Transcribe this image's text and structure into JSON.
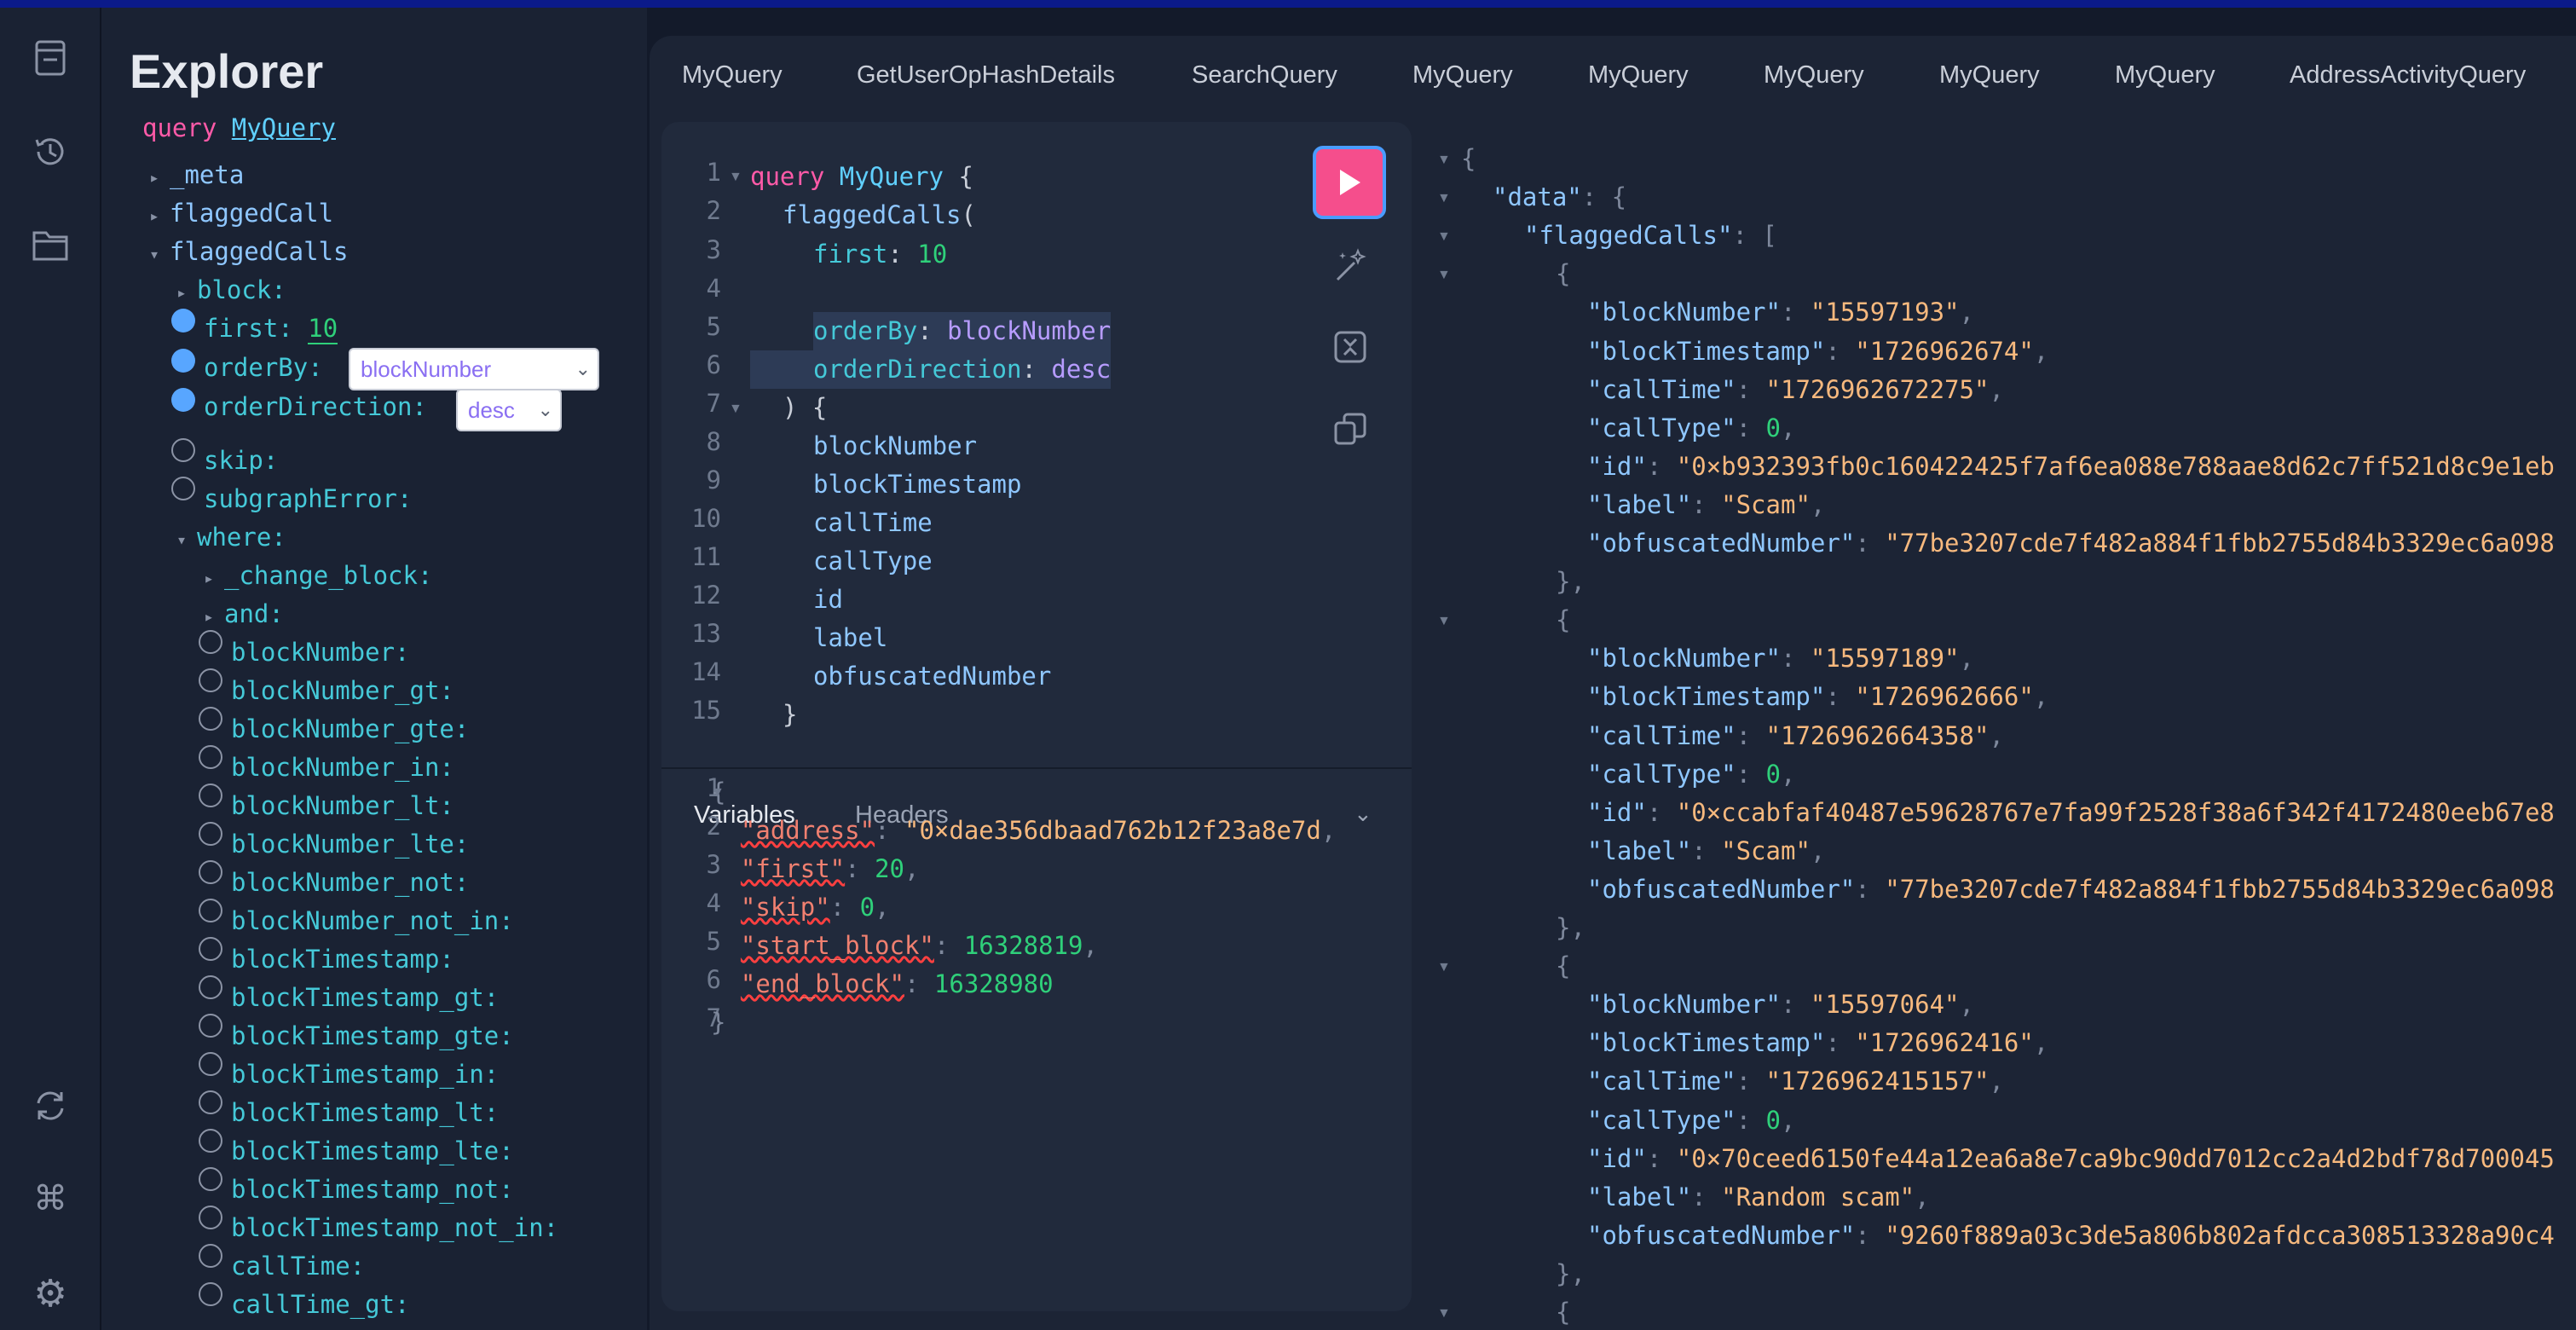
{
  "explorer": {
    "title": "Explorer",
    "query_keyword": "query",
    "query_name": "MyQuery",
    "meta": "_meta",
    "flaggedCall": "flaggedCall",
    "flaggedCalls": "flaggedCalls",
    "block": "block:",
    "first_label": "first:",
    "first_value": "10",
    "orderBy_label": "orderBy:",
    "orderBy_value": "blockNumber",
    "orderDirection_label": "orderDirection:",
    "orderDirection_value": "desc",
    "skip": "skip:",
    "subgraphError": "subgraphError:",
    "where": "where:",
    "change_block": "_change_block:",
    "and": "and:",
    "where_fields": [
      "blockNumber:",
      "blockNumber_gt:",
      "blockNumber_gte:",
      "blockNumber_in:",
      "blockNumber_lt:",
      "blockNumber_lte:",
      "blockNumber_not:",
      "blockNumber_not_in:",
      "blockTimestamp:",
      "blockTimestamp_gt:",
      "blockTimestamp_gte:",
      "blockTimestamp_in:",
      "blockTimestamp_lt:",
      "blockTimestamp_lte:",
      "blockTimestamp_not:",
      "blockTimestamp_not_in:",
      "callTime:",
      "callTime_gt:"
    ]
  },
  "tabs": [
    "MyQuery",
    "GetUserOpHashDetails",
    "SearchQuery",
    "MyQuery",
    "MyQuery",
    "MyQuery",
    "MyQuery",
    "MyQuery",
    "AddressActivityQuery"
  ],
  "editor": {
    "query_keyword": "query",
    "query_name": "MyQuery",
    "open_brace": "{",
    "field": "flaggedCalls",
    "first_key": "first",
    "first_value": "10",
    "orderBy_key": "orderBy",
    "orderBy_value": "blockNumber",
    "orderDirection_key": "orderDirection",
    "orderDirection_value": "desc",
    "close_args": ") {",
    "fields": [
      "blockNumber",
      "blockTimestamp",
      "callTime",
      "callType",
      "id",
      "label",
      "obfuscatedNumber"
    ],
    "close_brace": "}"
  },
  "variables_panel": {
    "variables_tab": "Variables",
    "headers_tab": "Headers",
    "vars": [
      {
        "key": "\"address\"",
        "value": "\"0×dae356dbaad762b12f23a8e7d",
        "type": "str"
      },
      {
        "key": "\"first\"",
        "value": "20",
        "type": "num"
      },
      {
        "key": "\"skip\"",
        "value": "0",
        "type": "num"
      },
      {
        "key": "\"start_block\"",
        "value": "16328819",
        "type": "num"
      },
      {
        "key": "\"end_block\"",
        "value": "16328980",
        "type": "num"
      }
    ]
  },
  "results": {
    "data_key": "\"data\"",
    "flaggedCalls_key": "\"flaggedCalls\"",
    "records": [
      {
        "blockNumber": "\"15597193\"",
        "blockTimestamp": "\"1726962674\"",
        "callTime": "\"1726962672275\"",
        "callType": "0",
        "id": "\"0×b932393fb0c160422425f7af6ea088e788aae8d62c7ff521d8c9e1eb",
        "label": "\"Scam\"",
        "obfuscatedNumber": "\"77be3207cde7f482a884f1fbb2755d84b3329ec6a098"
      },
      {
        "blockNumber": "\"15597189\"",
        "blockTimestamp": "\"1726962666\"",
        "callTime": "\"1726962664358\"",
        "callType": "0",
        "id": "\"0×ccabfaf40487e59628767e7fa99f2528f38a6f342f4172480eeb67e8",
        "label": "\"Scam\"",
        "obfuscatedNumber": "\"77be3207cde7f482a884f1fbb2755d84b3329ec6a098"
      },
      {
        "blockNumber": "\"15597064\"",
        "blockTimestamp": "\"1726962416\"",
        "callTime": "\"1726962415157\"",
        "callType": "0",
        "id": "\"0×70ceed6150fe44a12ea6a8e7ca9bc90dd7012cc2a4d2bdf78d700045",
        "label": "\"Random scam\"",
        "obfuscatedNumber": "\"9260f889a03c3de5a806b802afdcca308513328a90c4"
      }
    ]
  },
  "colors": {
    "keyword": "#ff5aa8",
    "field": "#8fc7ff",
    "argument": "#45c9d8",
    "number": "#2fd07a",
    "string": "#f7b97e",
    "run_button": "#f54e8c"
  }
}
